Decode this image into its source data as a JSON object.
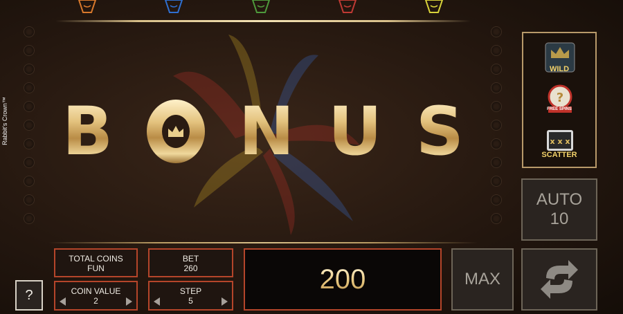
{
  "game": {
    "side_title": "Rabbit's Crown™"
  },
  "top_icons": [
    {
      "name": "orange-gem-icon",
      "color": "#d9792c"
    },
    {
      "name": "blue-gem-icon",
      "color": "#2f6fd0"
    },
    {
      "name": "green-gem-icon",
      "color": "#4e9a3c"
    },
    {
      "name": "red-gem-icon",
      "color": "#c03a34"
    },
    {
      "name": "yellow-gem-icon",
      "color": "#d8d23a"
    }
  ],
  "bonus": {
    "letters": [
      "B",
      "O",
      "N",
      "U",
      "S"
    ]
  },
  "symbols": {
    "wild_label": "WILD",
    "free_spins_label": "FREE SPINS",
    "scatter_label": "SCATTER"
  },
  "controls": {
    "auto_label": "AUTO",
    "auto_count": "10",
    "max_label": "MAX",
    "help_label": "?",
    "total_coins_label": "TOTAL COINS",
    "total_coins_value": "FUN",
    "bet_label": "BET",
    "bet_value": "260",
    "coin_value_label": "COIN VALUE",
    "coin_value_value": "2",
    "step_label": "STEP",
    "step_value": "5",
    "win_value": "200"
  }
}
